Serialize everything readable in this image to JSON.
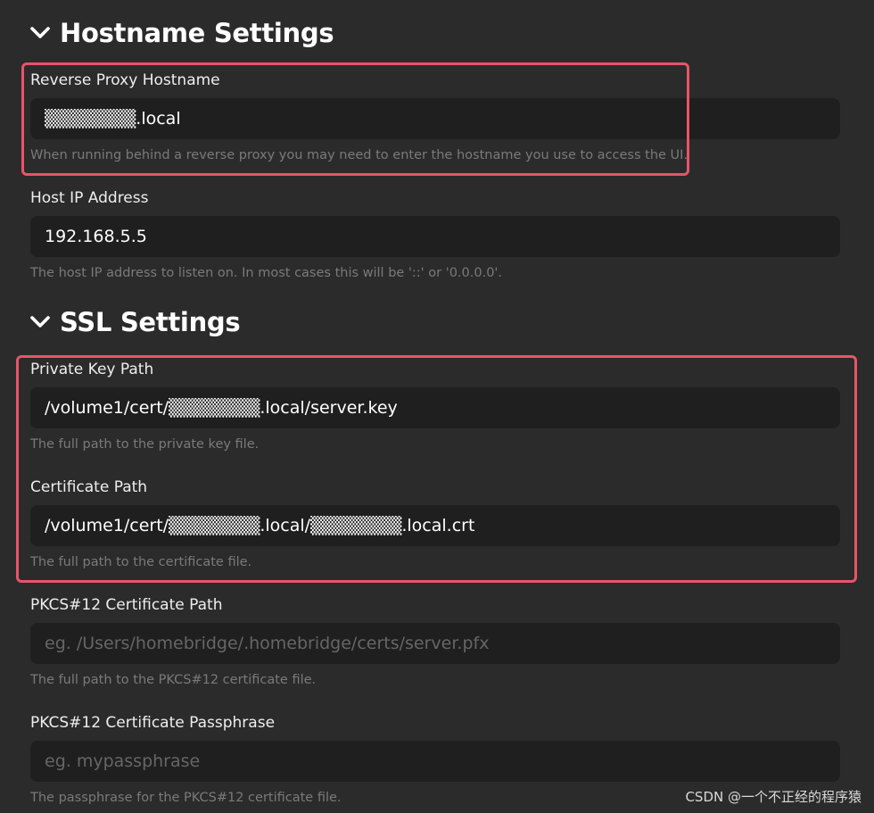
{
  "hostname_section": {
    "title": "Hostname Settings",
    "reverse_proxy": {
      "label": "Reverse Proxy Hostname",
      "value": "▒▒▒▒▒▒▒.local",
      "help": "When running behind a reverse proxy you may need to enter the hostname you use to access the UI."
    },
    "host_ip": {
      "label": "Host IP Address",
      "value": "192.168.5.5",
      "help": "The host IP address to listen on. In most cases this will be '::' or '0.0.0.0'."
    }
  },
  "ssl_section": {
    "title": "SSL Settings",
    "private_key": {
      "label": "Private Key Path",
      "value": "/volume1/cert/▒▒▒▒▒▒▒.local/server.key",
      "help": "The full path to the private key file."
    },
    "certificate": {
      "label": "Certificate Path",
      "value": "/volume1/cert/▒▒▒▒▒▒▒.local/▒▒▒▒▒▒▒.local.crt",
      "help": "The full path to the certificate file."
    },
    "pkcs12_path": {
      "label": "PKCS#12 Certificate Path",
      "placeholder": "eg. /Users/homebridge/.homebridge/certs/server.pfx",
      "help": "The full path to the PKCS#12 certificate file."
    },
    "pkcs12_passphrase": {
      "label": "PKCS#12 Certificate Passphrase",
      "placeholder": "eg. mypassphrase",
      "help": "The passphrase for the PKCS#12 certificate file."
    }
  },
  "watermark": "CSDN @一个不正经的程序猿",
  "colors": {
    "background": "#2b2b2b",
    "input_background": "#1f1f1f",
    "highlight_border": "#e8546a",
    "help_text": "#7a7a7a"
  },
  "icons": {
    "section_toggle": "chevron-down-icon"
  }
}
